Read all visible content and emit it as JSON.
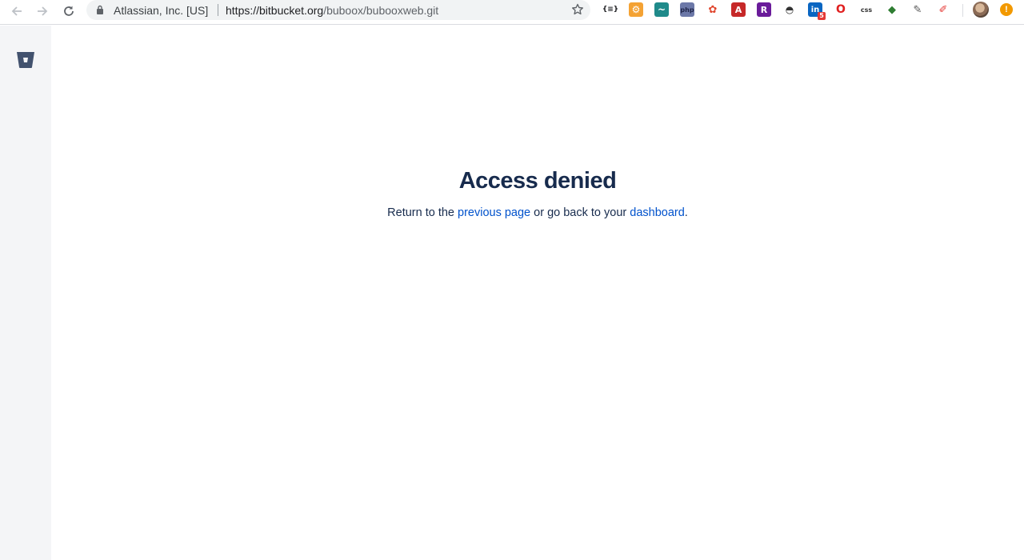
{
  "browser": {
    "site_identity": "Atlassian, Inc. [US]",
    "url_host": "https://bitbucket.org",
    "url_path": "/buboox/bubooxweb.git"
  },
  "extensions": [
    {
      "name": "json-viewer-icon",
      "glyph": "{≡}"
    },
    {
      "name": "gear-extension-icon",
      "glyph": "⚙"
    },
    {
      "name": "wave-extension-icon",
      "glyph": "~"
    },
    {
      "name": "php-extension-icon",
      "glyph": "php"
    },
    {
      "name": "colorful-extension-icon",
      "glyph": "✿"
    },
    {
      "name": "pdf-extension-icon",
      "glyph": "A"
    },
    {
      "name": "r-extension-icon",
      "glyph": "R"
    },
    {
      "name": "mask-extension-icon",
      "glyph": "◓"
    },
    {
      "name": "linkedin-extension-icon",
      "glyph": "in",
      "badge": "5"
    },
    {
      "name": "opera-extension-icon",
      "glyph": "O"
    },
    {
      "name": "css-extension-icon",
      "glyph": "css"
    },
    {
      "name": "color-wheel-extension-icon",
      "glyph": "◆"
    },
    {
      "name": "eyedropper-extension-icon",
      "glyph": "✎"
    },
    {
      "name": "pen-extension-icon",
      "glyph": "✐"
    }
  ],
  "page": {
    "title": "Access denied",
    "message_prefix": "Return to the ",
    "previous_link": "previous page",
    "message_middle": " or go back to your ",
    "dashboard_link": "dashboard",
    "message_suffix": "."
  },
  "colors": {
    "title": "#172b4d",
    "link": "#0052cc",
    "sidebar": "#f4f5f7"
  }
}
